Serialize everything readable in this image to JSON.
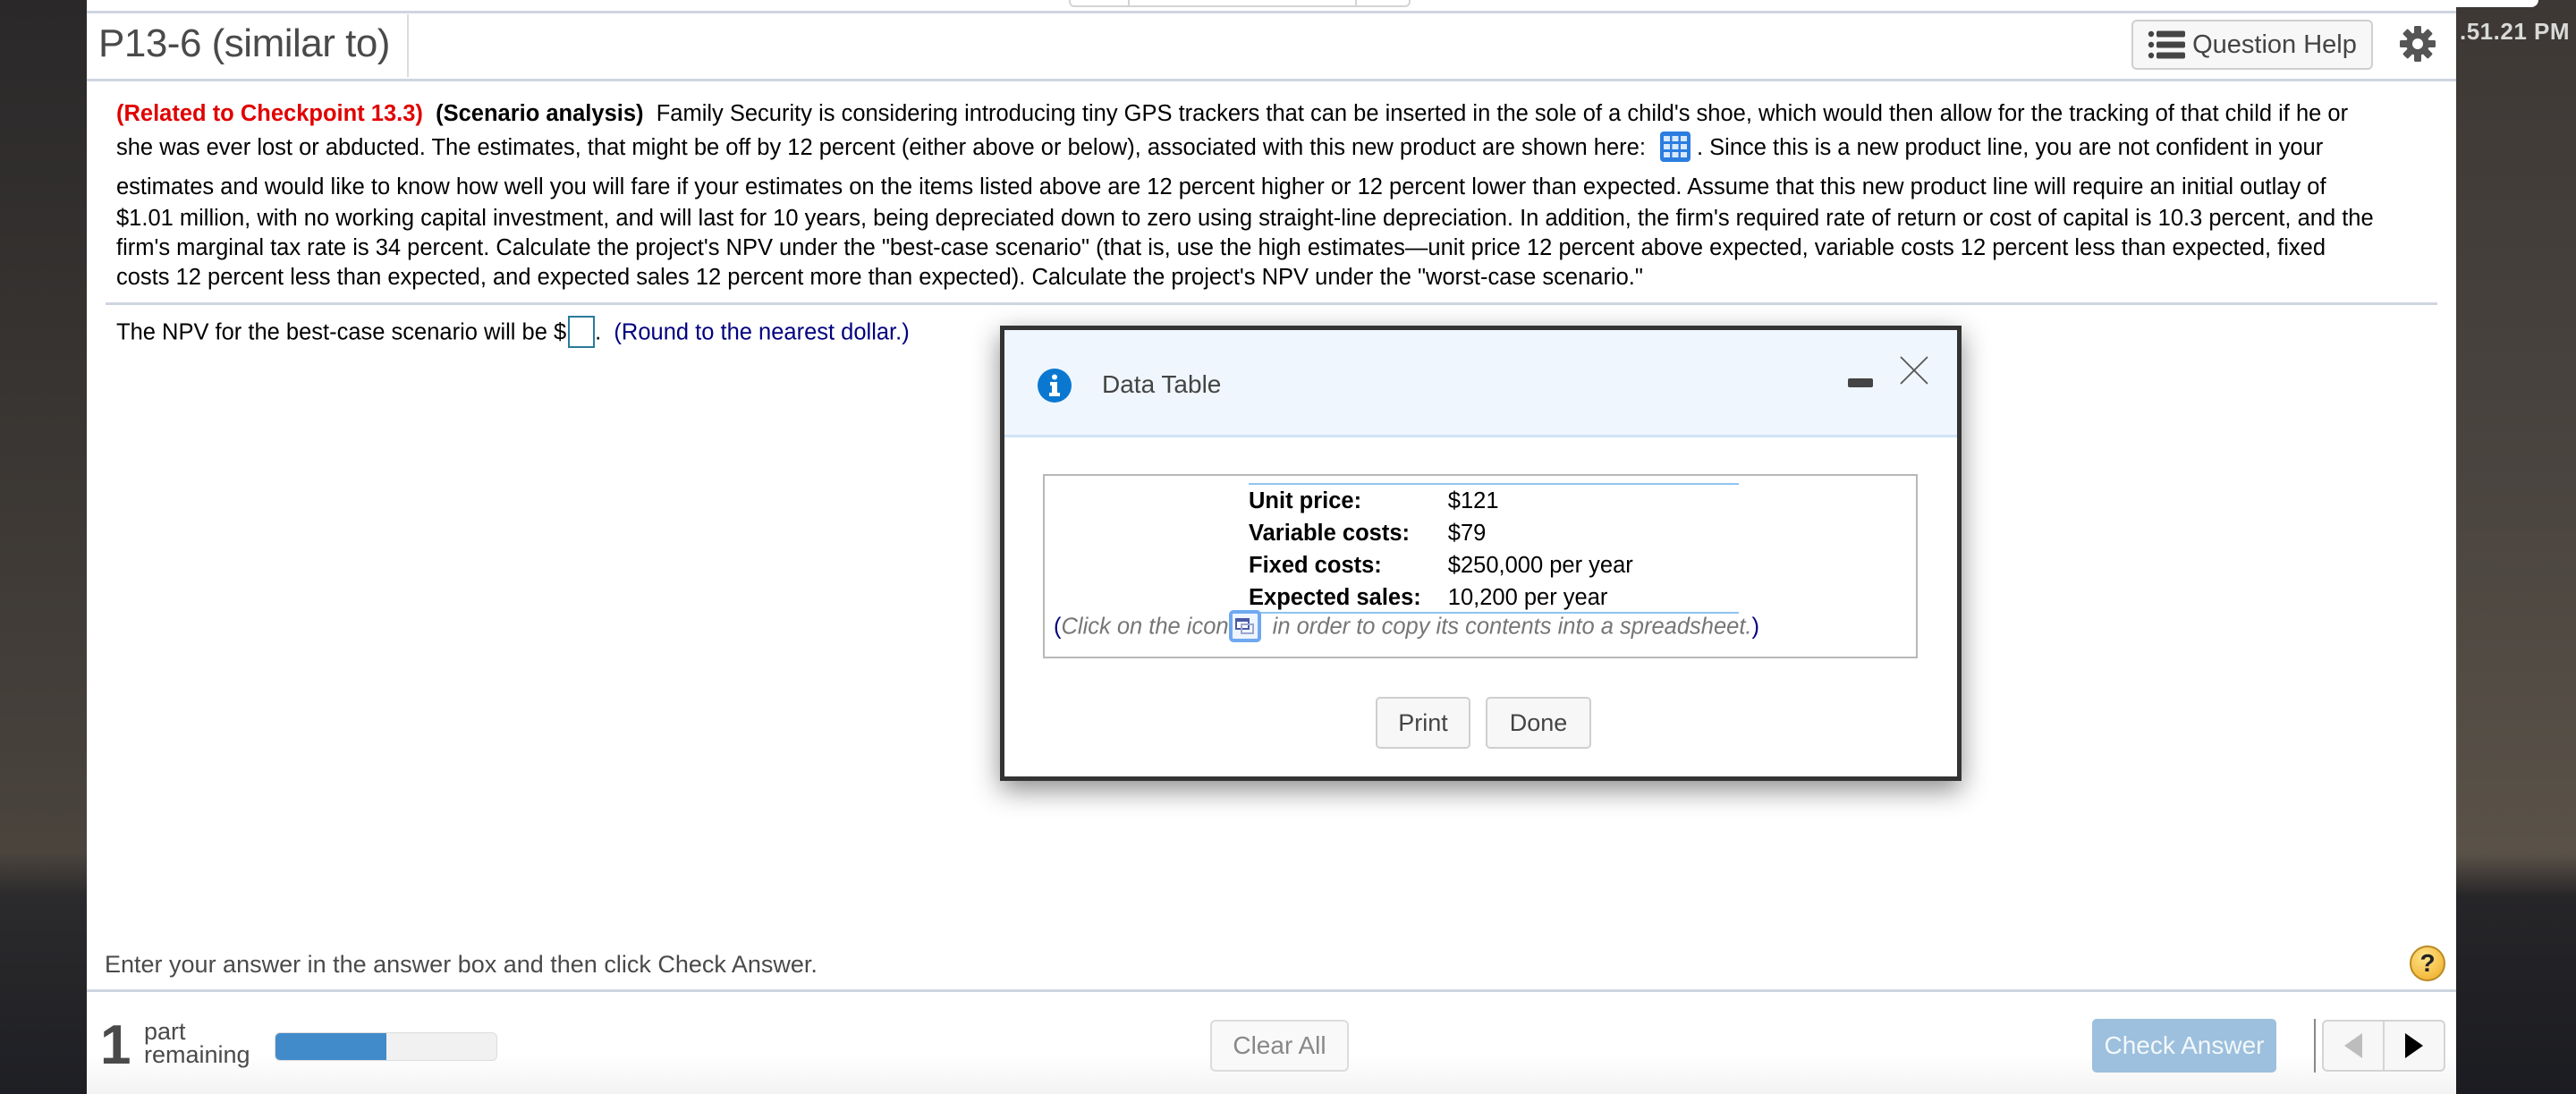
{
  "system": {
    "clock": ".51.21 PM"
  },
  "header": {
    "title": "P13-6 (similar to)",
    "question_help_label": "Question Help"
  },
  "problem": {
    "related_label": "(Related to Checkpoint 13.3)",
    "topic_label": "(Scenario analysis)",
    "lines": [
      "Family Security is considering introducing tiny GPS trackers that can be inserted in the sole of a child's shoe, which would then allow for the tracking of that child if he or",
      "she was ever lost or abducted.  The estimates, that might be off by 12 percent (either above or below), associated with this new product are shown  here: ",
      ".  Since this is a new product line, you are not confident in your",
      "estimates and would like to know how well you will fare if your estimates on the items listed above are 12 percent higher or 12 percent lower than expected.  Assume that this new product line will require an initial outlay of",
      "$1.01 million, with no working capital investment, and will last for 10 years, being depreciated down to zero using straight-line depreciation.  In addition, the firm's required rate of return or cost of capital is 10.3 percent, and the",
      "firm's marginal tax rate is 34 percent.  Calculate the project's NPV under the \"best-case scenario\" (that is, use the high estimates—unit price 12 percent above expected, variable costs 12 percent less than expected, fixed",
      "costs 12 percent less than expected, and expected sales 12 percent more than expected).  Calculate the project's NPV under the \"worst-case scenario.\""
    ]
  },
  "answer": {
    "prefix": "The NPV for the best-case scenario will be $",
    "value": "",
    "suffix": ".",
    "hint": "(Round to the nearest dollar.)"
  },
  "dialog": {
    "title": "Data Table",
    "rows": [
      {
        "label": "Unit price:",
        "value": "$121"
      },
      {
        "label": "Variable costs:",
        "value": "$79"
      },
      {
        "label": "Fixed costs:",
        "value": "$250,000 per year"
      },
      {
        "label": "Expected sales:",
        "value": "10,200 per year"
      }
    ],
    "note_open": "(",
    "note_before": "Click on the icon",
    "note_after": " in order to copy its contents into a spreadsheet.",
    "note_close": ")",
    "print_label": "Print",
    "done_label": "Done"
  },
  "footer": {
    "instruction": "Enter your answer in the answer box and then click Check Answer.",
    "help_symbol": "?",
    "parts_count": "1",
    "parts_label_1": "part",
    "parts_label_2": "remaining",
    "progress_fraction": 0.5,
    "clear_all_label": "Clear All",
    "check_answer_label": "Check Answer"
  },
  "colors": {
    "accent_red": "#e10000",
    "hint_navy": "#000080",
    "progress_blue": "#428bca",
    "check_answer_bg": "#9cc0dd",
    "info_blue": "#0a78d1"
  }
}
